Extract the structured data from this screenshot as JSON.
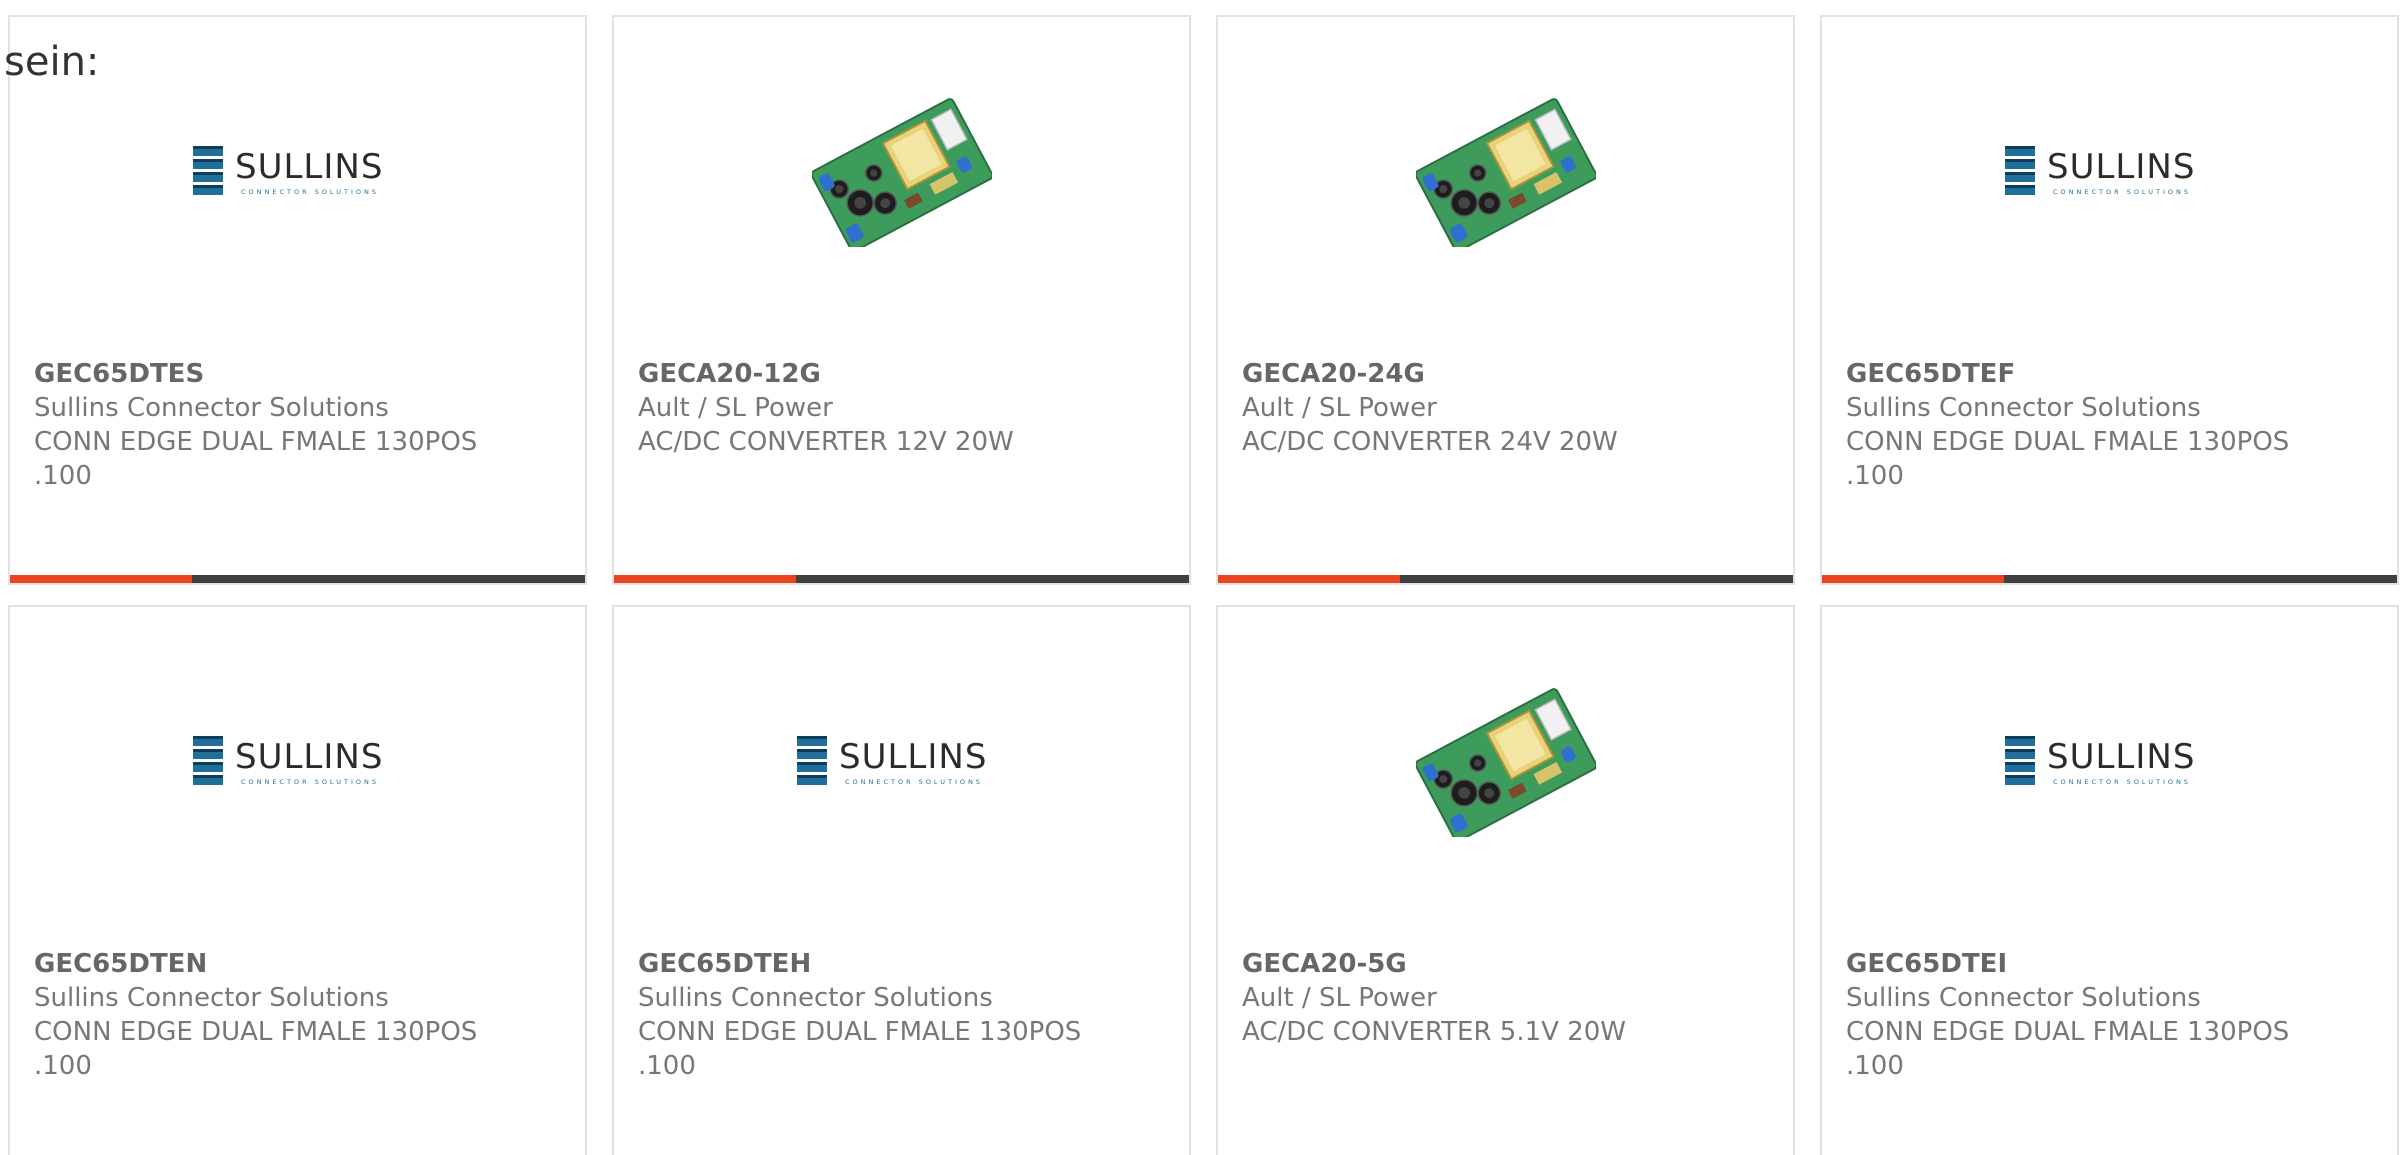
{
  "intro_text": "sein:",
  "colors": {
    "accent": "#e8441e",
    "bar": "#3f3f3f",
    "card_border": "#e2e2e2",
    "sullins_blue": "#1f6f9a",
    "sullins_text": "#2b2b2b"
  },
  "products": [
    {
      "part_number": "GEC65DTES",
      "manufacturer": "Sullins Connector Solutions",
      "description": "CONN EDGE DUAL FMALE 130POS .100",
      "image": "sullins-logo"
    },
    {
      "part_number": "GECA20-12G",
      "manufacturer": "Ault / SL Power",
      "description": "AC/DC CONVERTER 12V 20W",
      "image": "power-supply-board"
    },
    {
      "part_number": "GECA20-24G",
      "manufacturer": "Ault / SL Power",
      "description": "AC/DC CONVERTER 24V 20W",
      "image": "power-supply-board"
    },
    {
      "part_number": "GEC65DTEF",
      "manufacturer": "Sullins Connector Solutions",
      "description": "CONN EDGE DUAL FMALE 130POS .100",
      "image": "sullins-logo"
    },
    {
      "part_number": "GEC65DTEN",
      "manufacturer": "Sullins Connector Solutions",
      "description": "CONN EDGE DUAL FMALE 130POS .100",
      "image": "sullins-logo"
    },
    {
      "part_number": "GEC65DTEH",
      "manufacturer": "Sullins Connector Solutions",
      "description": "CONN EDGE DUAL FMALE 130POS .100",
      "image": "sullins-logo"
    },
    {
      "part_number": "GECA20-5G",
      "manufacturer": "Ault / SL Power",
      "description": "AC/DC CONVERTER 5.1V 20W",
      "image": "power-supply-board"
    },
    {
      "part_number": "GEC65DTEI",
      "manufacturer": "Sullins Connector Solutions",
      "description": "CONN EDGE DUAL FMALE 130POS .100",
      "image": "sullins-logo"
    }
  ],
  "logo_text": {
    "wordmark": "SULLINS",
    "tagline": "CONNECTOR SOLUTIONS"
  }
}
